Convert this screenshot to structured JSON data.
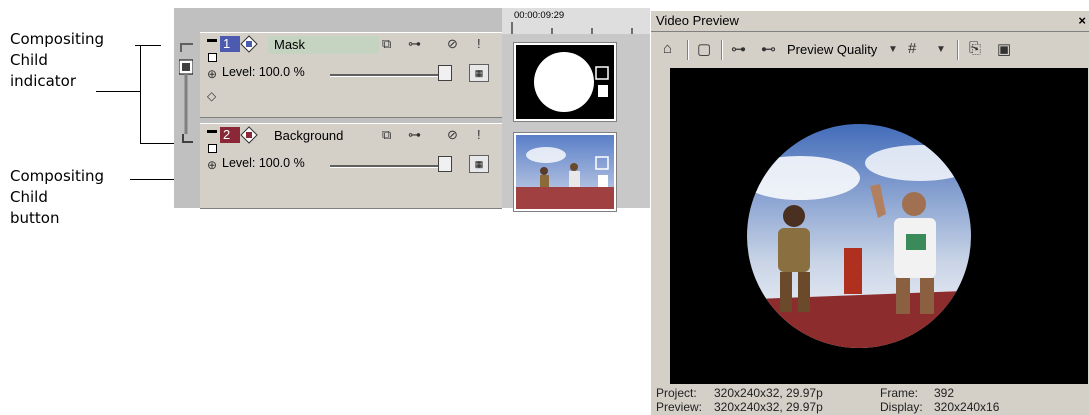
{
  "callouts": {
    "indicator": [
      "Compositing",
      "Child",
      "indicator"
    ],
    "button": [
      "Compositing",
      "Child",
      "button"
    ]
  },
  "tracks": [
    {
      "number": "1",
      "name": "Mask",
      "level": "Level: 100.0 %",
      "color": "#4c5bb0"
    },
    {
      "number": "2",
      "name": "Background",
      "level": "Level: 100.0 %",
      "color": "#8a2838"
    }
  ],
  "timeline": {
    "time_code": "00:00:09:29"
  },
  "preview": {
    "title": "Video Preview",
    "close_label": "×",
    "quality_label": "Preview Quality",
    "status": {
      "project_label": "Project:",
      "project_value": "320x240x32, 29.97p",
      "preview_label": "Preview:",
      "preview_value": "320x240x32, 29.97p",
      "frame_label": "Frame:",
      "frame_value": "392",
      "display_label": "Display:",
      "display_value": "320x240x16"
    }
  },
  "icons": [
    "properties-icon",
    "overlay-icon",
    "split-icon",
    "external-monitor-icon",
    "grid-icon",
    "copy-icon",
    "save-icon",
    "mute-icon",
    "solo-icon",
    "compositing-mode-icon",
    "pan-crop-icon"
  ]
}
